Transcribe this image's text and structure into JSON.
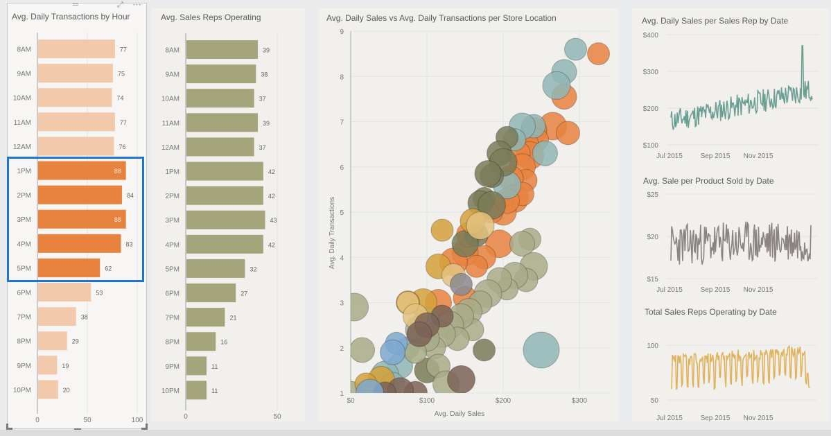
{
  "panel_controls": {
    "drag_handle": "═",
    "focus_mode": "⤢",
    "more_options": "⋯"
  },
  "colors": {
    "highlight_border": "#1f74d1",
    "bar_highlight": "#e8833f",
    "bar_faded": "#f2c9ab",
    "bar_reps": "#a5a57c",
    "line_sales": "#6b9f94",
    "line_product": "#8b8482",
    "line_reps": "#e1b25c"
  },
  "chart_data": [
    {
      "id": "transactions_by_hour",
      "type": "bar",
      "orientation": "horizontal",
      "title": "Avg. Daily Transactions by Hour",
      "categories": [
        "8AM",
        "9AM",
        "10AM",
        "11AM",
        "12AM",
        "1PM",
        "2PM",
        "3PM",
        "4PM",
        "5PM",
        "6PM",
        "7PM",
        "8PM",
        "9PM",
        "10PM"
      ],
      "values": [
        77,
        75,
        74,
        77,
        76,
        88,
        84,
        88,
        83,
        62,
        53,
        38,
        29,
        19,
        20
      ],
      "highlighted": [
        "1PM",
        "2PM",
        "3PM",
        "4PM",
        "5PM"
      ],
      "xlim": [
        0,
        100
      ],
      "xticks": [
        0,
        50,
        100
      ],
      "grid": true
    },
    {
      "id": "reps_by_hour",
      "type": "bar",
      "orientation": "horizontal",
      "title": "Avg. Sales Reps Operating",
      "categories": [
        "8AM",
        "9AM",
        "10AM",
        "11AM",
        "12AM",
        "1PM",
        "2PM",
        "3PM",
        "4PM",
        "5PM",
        "6PM",
        "7PM",
        "8PM",
        "9PM",
        "10PM"
      ],
      "values": [
        39,
        38,
        37,
        39,
        37,
        42,
        42,
        43,
        42,
        32,
        27,
        21,
        16,
        11,
        11
      ],
      "xlim": [
        0,
        50
      ],
      "xticks": [
        0,
        50
      ],
      "grid": true
    },
    {
      "id": "sales_vs_transactions",
      "type": "scatter",
      "title": "Avg. Daily Sales vs Avg. Daily Transactions per Store Location",
      "xlabel": "Avg. Daily Sales",
      "ylabel": "Avg. Daily Transactions",
      "xlim": [
        0,
        340
      ],
      "ylim": [
        1,
        9
      ],
      "xticks": [
        "$0",
        "$100",
        "$200",
        "$300"
      ],
      "xtick_values": [
        0,
        100,
        200,
        300
      ],
      "yticks": [
        1,
        2,
        3,
        4,
        5,
        6,
        7,
        8,
        9
      ],
      "grid": true,
      "series": [
        {
          "name": "orange",
          "color": "#e8833f",
          "points": [
            [
              325,
              8.5
            ],
            [
              280,
              7.55
            ],
            [
              265,
              6.9
            ],
            [
              285,
              6.75
            ],
            [
              240,
              6.8
            ],
            [
              245,
              6.6
            ],
            [
              230,
              6.5
            ],
            [
              235,
              6.25
            ],
            [
              220,
              6.3
            ],
            [
              225,
              6.0
            ],
            [
              230,
              5.7
            ],
            [
              210,
              5.75
            ],
            [
              215,
              5.3
            ],
            [
              225,
              5.4
            ],
            [
              200,
              5.0
            ],
            [
              185,
              5.0
            ],
            [
              205,
              5.25
            ],
            [
              195,
              4.3
            ],
            [
              175,
              4.0
            ],
            [
              150,
              4.1
            ],
            [
              165,
              3.8
            ],
            [
              155,
              4.5
            ],
            [
              135,
              3.9
            ],
            [
              150,
              3.1
            ],
            [
              115,
              3.0
            ]
          ]
        },
        {
          "name": "teal",
          "color": "#8fb6b4",
          "points": [
            [
              295,
              8.6
            ],
            [
              280,
              8.1
            ],
            [
              270,
              7.8
            ],
            [
              240,
              6.9
            ],
            [
              225,
              6.9
            ],
            [
              215,
              6.6
            ],
            [
              255,
              6.3
            ],
            [
              205,
              5.6
            ],
            [
              250,
              1.95
            ],
            [
              100,
              2.6
            ],
            [
              75,
              2.0
            ],
            [
              65,
              1.6
            ],
            [
              45,
              1.4
            ],
            [
              55,
              1.2
            ]
          ]
        },
        {
          "name": "dark-olive",
          "color": "#7a7b58",
          "points": [
            [
              205,
              6.65
            ],
            [
              195,
              6.3
            ],
            [
              200,
              6.1
            ],
            [
              185,
              5.8
            ],
            [
              180,
              5.85
            ],
            [
              175,
              5.3
            ],
            [
              170,
              5.2
            ],
            [
              185,
              5.15
            ],
            [
              165,
              4.5
            ],
            [
              150,
              4.3
            ],
            [
              175,
              1.95
            ],
            [
              100,
              1.5
            ]
          ]
        },
        {
          "name": "olive",
          "color": "#a8ab87",
          "points": [
            [
              235,
              4.4
            ],
            [
              225,
              4.3
            ],
            [
              240,
              3.8
            ],
            [
              230,
              3.5
            ],
            [
              215,
              3.6
            ],
            [
              205,
              3.3
            ],
            [
              195,
              3.5
            ],
            [
              180,
              3.2
            ],
            [
              170,
              3.0
            ],
            [
              155,
              2.8
            ],
            [
              160,
              2.4
            ],
            [
              145,
              2.7
            ],
            [
              130,
              2.5
            ],
            [
              140,
              2.2
            ],
            [
              120,
              2.3
            ],
            [
              110,
              2.0
            ],
            [
              100,
              2.2
            ],
            [
              90,
              2.4
            ],
            [
              115,
              1.6
            ],
            [
              125,
              1.2
            ],
            [
              85,
              1.9
            ],
            [
              15,
              1.95
            ],
            [
              5,
              2.9
            ],
            [
              0,
              1.0
            ]
          ]
        },
        {
          "name": "gold",
          "color": "#d4a13a",
          "points": [
            [
              120,
              4.6
            ],
            [
              115,
              3.8
            ],
            [
              95,
              3.0
            ],
            [
              75,
              3.0
            ],
            [
              40,
              1.3
            ],
            [
              20,
              1.2
            ],
            [
              160,
              4.8
            ]
          ]
        },
        {
          "name": "tan",
          "color": "#e3c27f",
          "points": [
            [
              75,
              3.0
            ],
            [
              85,
              2.7
            ],
            [
              170,
              4.7
            ],
            [
              135,
              3.6
            ]
          ]
        },
        {
          "name": "brown",
          "color": "#7c6356",
          "points": [
            [
              120,
              2.7
            ],
            [
              100,
              2.5
            ],
            [
              145,
              1.3
            ],
            [
              85,
              1.0
            ],
            [
              65,
              1.05
            ],
            [
              45,
              1.0
            ],
            [
              90,
              2.3
            ]
          ]
        },
        {
          "name": "blue",
          "color": "#7fa8cf",
          "points": [
            [
              60,
              2.1
            ],
            [
              55,
              1.9
            ],
            [
              25,
              1.0
            ]
          ]
        },
        {
          "name": "slate",
          "color": "#8c8a90",
          "points": [
            [
              145,
              3.4
            ]
          ]
        }
      ]
    },
    {
      "id": "sales_per_rep_by_date",
      "type": "line",
      "title": "Avg. Daily Sales per Sales Rep by Date",
      "ylim": [
        100,
        400
      ],
      "yticks": [
        "$100",
        "$200",
        "$300",
        "$400"
      ],
      "ytick_values": [
        100,
        200,
        300,
        400
      ],
      "xticks": [
        "Jul 2015",
        "Sep 2015",
        "Nov 2015"
      ],
      "grid": true,
      "x_start_offset": 0.03,
      "trend": {
        "start": 165,
        "end": 250,
        "noise": 32,
        "spike_index": 0.93,
        "spike_value": 370
      }
    },
    {
      "id": "sale_per_product_by_date",
      "type": "line",
      "title": "Avg. Sale per Product Sold by Date",
      "ylim": [
        15,
        25
      ],
      "yticks": [
        "$15",
        "$20",
        "$25"
      ],
      "ytick_values": [
        15,
        20,
        25
      ],
      "xticks": [
        "Jul 2015",
        "Sep 2015",
        "Nov 2015"
      ],
      "grid": true,
      "trend": {
        "start": 19,
        "end": 19.5,
        "noise": 2.5,
        "min": 15.5,
        "max": 24
      }
    },
    {
      "id": "reps_operating_by_date",
      "type": "line",
      "title": "Total Sales Reps Operating by Date",
      "ylim": [
        45,
        115
      ],
      "yticks": [
        "50",
        "100"
      ],
      "ytick_values": [
        50,
        100
      ],
      "xticks": [
        "Jul 2015",
        "Sep 2015",
        "Nov 2015"
      ],
      "grid": true,
      "trend": {
        "start": 82,
        "end": 92,
        "noise": 18,
        "weekly_period": 7,
        "end_drop": 55
      }
    }
  ]
}
